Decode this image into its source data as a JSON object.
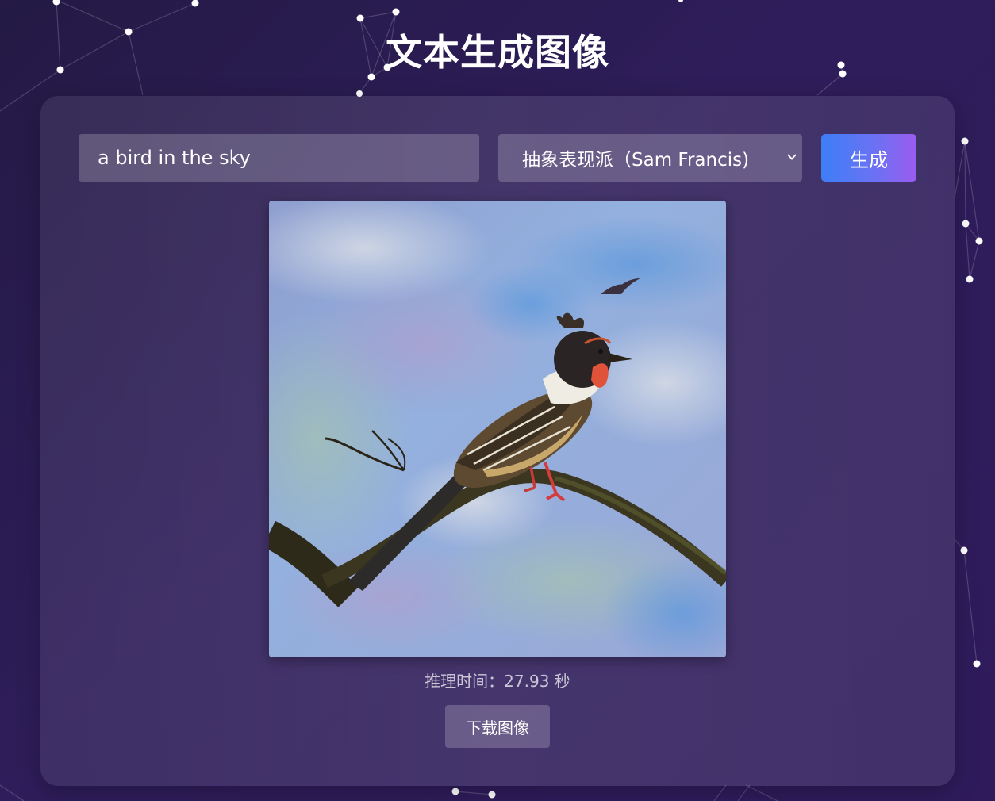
{
  "header": {
    "title": "文本生成图像"
  },
  "form": {
    "prompt_value": "a bird in the sky",
    "style_selected": "抽象表现派（Sam Francis)",
    "generate_label": "生成"
  },
  "result": {
    "image_icon": "bird-painting-image",
    "inference_time_text": "推理时间：27.93 秒",
    "download_label": "下载图像"
  },
  "colors": {
    "background": "#2a1c52",
    "button_gradient_start": "#3d7ef7",
    "button_gradient_end": "#9a5cf0"
  }
}
